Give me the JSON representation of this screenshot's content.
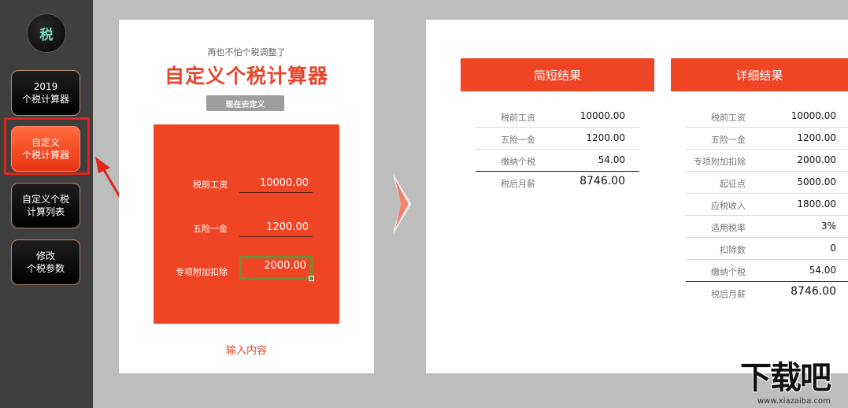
{
  "sidebar": {
    "logo": "税",
    "items": [
      {
        "line1": "2019",
        "line2": "个税计算器"
      },
      {
        "line1": "自定义",
        "line2": "个税计算器"
      },
      {
        "line1": "自定义个税",
        "line2": "计算列表"
      },
      {
        "line1": "修改",
        "line2": "个税参数"
      }
    ],
    "active_index": 1
  },
  "input_panel": {
    "subtitle": "再也不怕个税调整了",
    "title": "自定义个税计算器",
    "define_button": "现在去定义",
    "fields": [
      {
        "label": "税前工资",
        "value": "10000.00"
      },
      {
        "label": "五险一金",
        "value": "1200.00"
      },
      {
        "label": "专项附加扣除",
        "value": "2000.00"
      }
    ],
    "hint": "输入内容"
  },
  "brief_result": {
    "title": "简短结果",
    "rows": [
      {
        "label": "税前工资",
        "value": "10000.00"
      },
      {
        "label": "五险一金",
        "value": "1200.00"
      },
      {
        "label": "缴纳个税",
        "value": "54.00"
      },
      {
        "label": "税后月薪",
        "value": "8746.00"
      }
    ]
  },
  "detail_result": {
    "title": "详细结果",
    "rows": [
      {
        "label": "税前工资",
        "value": "10000.00"
      },
      {
        "label": "五险一金",
        "value": "1200.00"
      },
      {
        "label": "专项附加扣除",
        "value": "2000.00"
      },
      {
        "label": "起征点",
        "value": "5000.00"
      },
      {
        "label": "应税收入",
        "value": "1800.00"
      },
      {
        "label": "适用税率",
        "value": "3%"
      },
      {
        "label": "扣除数",
        "value": "0"
      },
      {
        "label": "缴纳个税",
        "value": "54.00"
      },
      {
        "label": "税后月薪",
        "value": "8746.00"
      }
    ]
  },
  "watermark": {
    "main": "下载吧",
    "url": "www.xiazaiba.com"
  },
  "colors": {
    "accent": "#f04525",
    "sidebar": "#3f3f3f",
    "highlight": "#e0261c"
  }
}
